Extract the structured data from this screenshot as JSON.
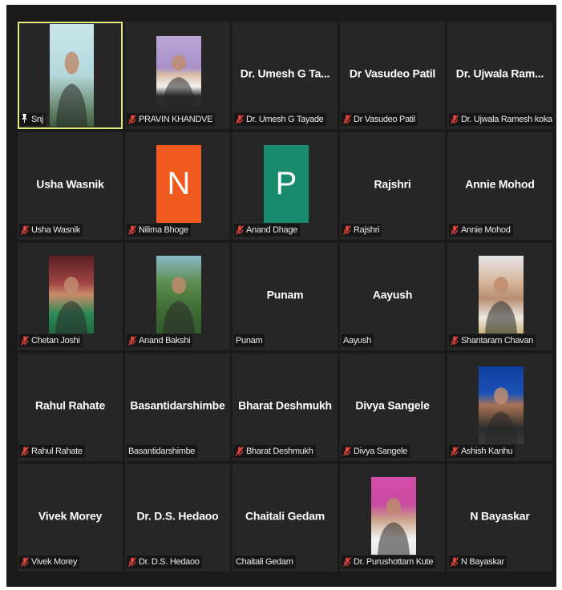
{
  "participants": [
    {
      "tile": "video",
      "label": "Snj",
      "pinned": true,
      "muted": false
    },
    {
      "tile": "photo",
      "label": "PRAVIN KHANDVE",
      "muted": true
    },
    {
      "tile": "name",
      "display": "Dr. Umesh G Ta...",
      "label": "Dr. Umesh G Tayade",
      "muted": true
    },
    {
      "tile": "name",
      "display": "Dr Vasudeo Patil",
      "label": "Dr Vasudeo Patil",
      "muted": true
    },
    {
      "tile": "name",
      "display": "Dr. Ujwala Ram...",
      "label": "Dr. Ujwala Ramesh  kokate",
      "muted": true
    },
    {
      "tile": "name",
      "display": "Usha Wasnik",
      "label": "Usha Wasnik",
      "muted": true
    },
    {
      "tile": "letter",
      "letter": "N",
      "color": "#f05a1e",
      "label": "Nilima Bhoge",
      "muted": true
    },
    {
      "tile": "letter",
      "letter": "P",
      "color": "#1a8a6e",
      "label": "Anand Dhage",
      "muted": true
    },
    {
      "tile": "name",
      "display": "Rajshri",
      "label": "Rajshri",
      "muted": true
    },
    {
      "tile": "name",
      "display": "Annie Mohod",
      "label": "Annie Mohod",
      "muted": true
    },
    {
      "tile": "photo",
      "label": "Chetan Joshi",
      "muted": true
    },
    {
      "tile": "photo",
      "label": "Anand Bakshi",
      "muted": true
    },
    {
      "tile": "name",
      "display": "Punam",
      "label": "Punam",
      "muted": false
    },
    {
      "tile": "name",
      "display": "Aayush",
      "label": "Aayush",
      "muted": false
    },
    {
      "tile": "photo",
      "label": "Shantaram Chavan",
      "muted": true
    },
    {
      "tile": "name",
      "display": "Rahul Rahate",
      "label": "Rahul Rahate",
      "muted": true
    },
    {
      "tile": "name",
      "display": "Basantidarshimbe",
      "label": "Basantidarshimbe",
      "muted": false
    },
    {
      "tile": "name",
      "display": "Bharat Deshmukh",
      "label": "Bharat Deshmukh",
      "muted": true
    },
    {
      "tile": "name",
      "display": "Divya Sangele",
      "label": "Divya Sangele",
      "muted": true
    },
    {
      "tile": "photo",
      "label": "Ashish Kanhu",
      "muted": true
    },
    {
      "tile": "name",
      "display": "Vivek Morey",
      "label": "Vivek Morey",
      "muted": true
    },
    {
      "tile": "name",
      "display": "Dr. D.S. Hedaoo",
      "label": "Dr. D.S. Hedaoo",
      "muted": true
    },
    {
      "tile": "name",
      "display": "Chaitali Gedam",
      "label": "Chaitali Gedam",
      "muted": false
    },
    {
      "tile": "photo",
      "label": "Dr. Purushottam Kute",
      "muted": true
    },
    {
      "tile": "name",
      "display": "N Bayaskar",
      "label": "N Bayaskar",
      "muted": true
    }
  ],
  "colors": {
    "mute_icon": "#e0433a",
    "active_border": "#e3e87a",
    "tile_bg": "#262626",
    "frame_bg": "#1a1a1a"
  }
}
